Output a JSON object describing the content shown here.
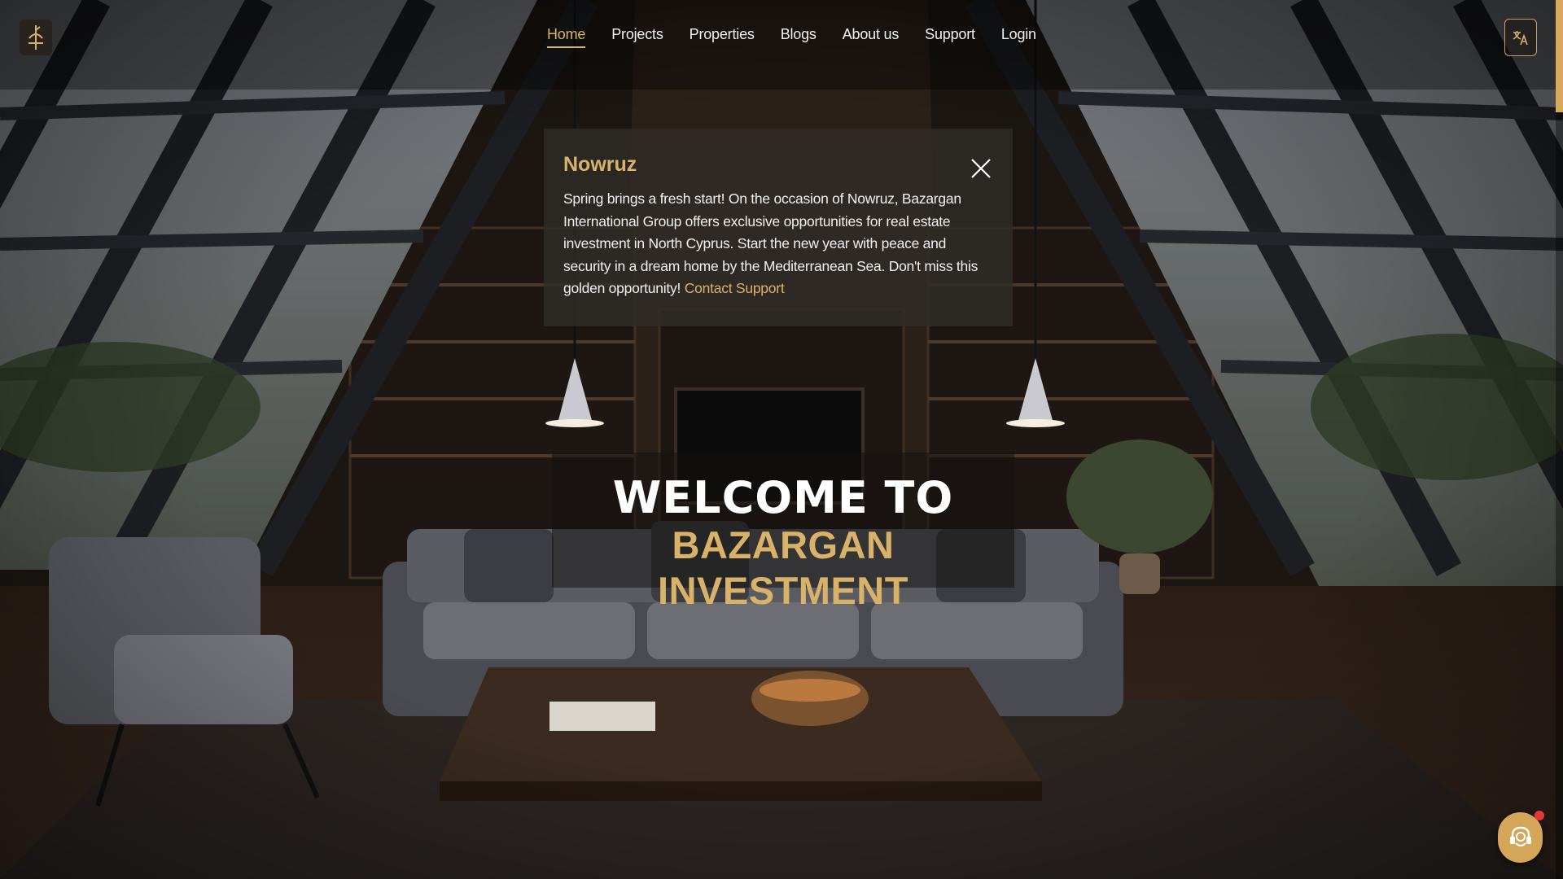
{
  "header": {
    "logo_icon": "bazargan-logo-icon",
    "nav": [
      {
        "label": "Home",
        "active": true
      },
      {
        "label": "Projects",
        "active": false
      },
      {
        "label": "Properties",
        "active": false
      },
      {
        "label": "Blogs",
        "active": false
      },
      {
        "label": "About us",
        "active": false
      },
      {
        "label": "Support",
        "active": false
      },
      {
        "label": "Login",
        "active": false
      }
    ],
    "language_icon": "translate-icon"
  },
  "popup": {
    "title": "Nowruz",
    "body": "Spring brings a fresh start! On the occasion of Nowruz, Bazargan International Group offers exclusive opportunities for real estate investment in North Cyprus. Start the new year with peace and security in a dream home by the Mediterranean Sea. Don't miss this golden opportunity!",
    "link": "Contact Support",
    "close_icon": "close-icon"
  },
  "hero": {
    "line1": "WELCOME TO",
    "line2": "BAZARGAN INVESTMENT"
  },
  "chat": {
    "icon": "support-agent-icon",
    "has_notification": true
  },
  "colors": {
    "accent": "#d9b26a",
    "notification": "#e53935"
  }
}
